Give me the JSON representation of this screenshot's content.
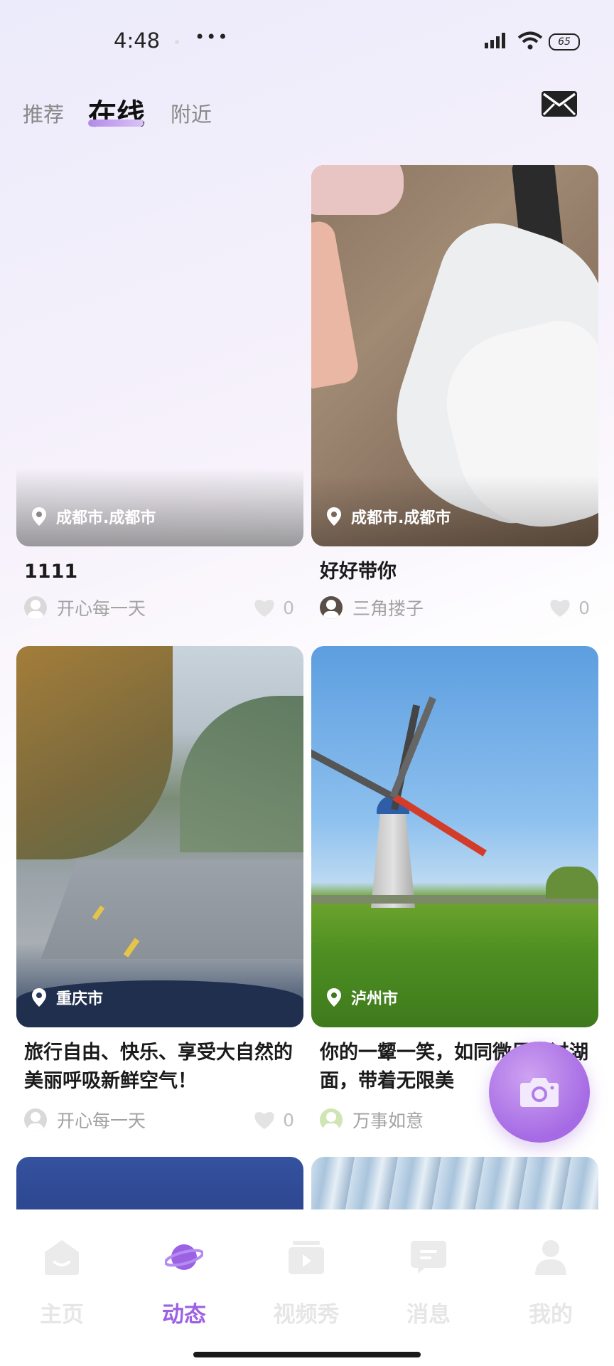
{
  "status_bar": {
    "time": "4:48",
    "more": "•••",
    "battery": "65"
  },
  "tabs": [
    {
      "label": "推荐",
      "active": false
    },
    {
      "label": "在线",
      "active": true
    },
    {
      "label": "附近",
      "active": false
    }
  ],
  "icons": {
    "mail": "mail-icon",
    "camera": "camera-icon",
    "location": "location-pin-icon",
    "like": "heart-icon"
  },
  "feed": [
    {
      "location": "成都市.成都市",
      "title": "1111",
      "author": "开心每一天",
      "likes": "0"
    },
    {
      "location": "成都市.成都市",
      "title": "好好带你",
      "author": "三角搂子",
      "likes": "0"
    },
    {
      "location": "重庆市",
      "title": "旅行自由、快乐、享受大自然的美丽呼吸新鲜空气！",
      "author": "开心每一天",
      "likes": "0"
    },
    {
      "location": "泸州市",
      "title": "你的一颦一笑，如同微风拂过湖面，带着无限美",
      "author": "万事如意",
      "likes": ""
    }
  ],
  "nav": [
    {
      "label": "主页",
      "icon": "home-icon",
      "active": false
    },
    {
      "label": "动态",
      "icon": "planet-icon",
      "active": true
    },
    {
      "label": "视频秀",
      "icon": "video-icon",
      "active": false
    },
    {
      "label": "消息",
      "icon": "message-icon",
      "active": false
    },
    {
      "label": "我的",
      "icon": "profile-icon",
      "active": false
    }
  ],
  "colors": {
    "accent": "#9d61e3",
    "fab": "#b07be8"
  }
}
